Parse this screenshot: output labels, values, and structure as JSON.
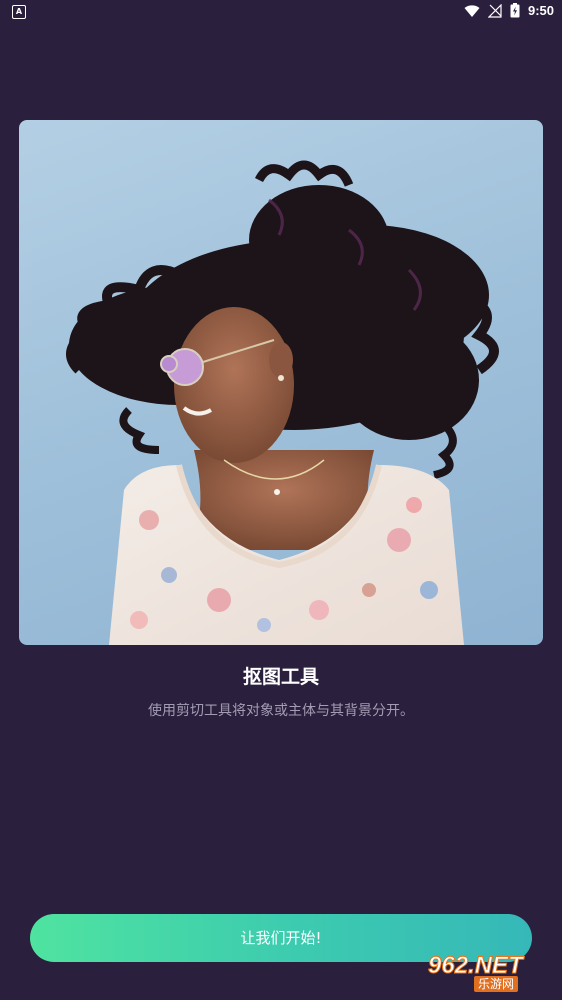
{
  "status_bar": {
    "notification_icon": "a-notification-icon",
    "time": "9:50",
    "icons": [
      "wifi-icon",
      "signal-icon",
      "battery-icon"
    ]
  },
  "main": {
    "image_alt": "photo-of-woman-with-curly-hair",
    "title": "抠图工具",
    "subtitle": "使用剪切工具将对象或主体与其背景分开。"
  },
  "actions": {
    "start_label": "让我们开始!"
  },
  "watermark": {
    "brand": "962.NET",
    "sub": "乐游网"
  },
  "colors": {
    "background": "#2a1f3d",
    "button_gradient_start": "#4fe3a0",
    "button_gradient_end": "#36b8b8",
    "subtitle": "#a49cb4"
  }
}
